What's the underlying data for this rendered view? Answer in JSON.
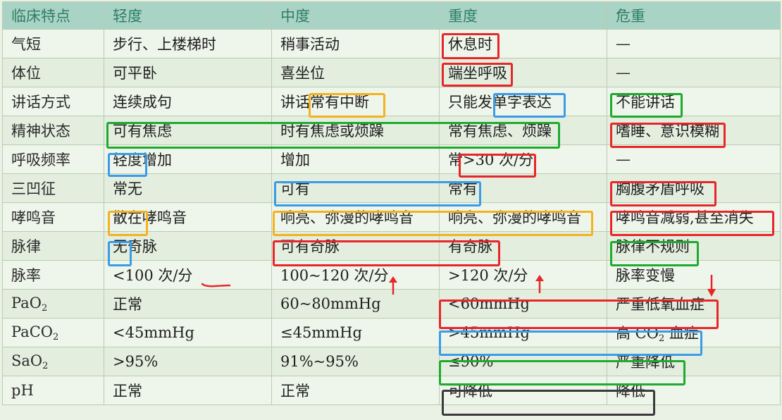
{
  "headers": [
    "临床特点",
    "轻度",
    "中度",
    "重度",
    "危重"
  ],
  "rows": [
    {
      "feature": "气短",
      "mild": "步行、上楼梯时",
      "moderate": "稍事活动",
      "severe": "休息时",
      "critical": "—"
    },
    {
      "feature": "体位",
      "mild": "可平卧",
      "moderate": "喜坐位",
      "severe": "端坐呼吸",
      "critical": "—"
    },
    {
      "feature": "讲话方式",
      "mild": "连续成句",
      "moderate": "讲话常有中断",
      "severe": "只能发单字表达",
      "critical": "不能讲话"
    },
    {
      "feature": "精神状态",
      "mild": "可有焦虑",
      "moderate": "时有焦虑或烦躁",
      "severe": "常有焦虑、烦躁",
      "critical": "嗜睡、意识模糊"
    },
    {
      "feature": "呼吸频率",
      "mild": "轻度增加",
      "moderate": "增加",
      "severe": "常>30 次/分",
      "critical": "—"
    },
    {
      "feature": "三凹征",
      "mild": "常无",
      "moderate": "可有",
      "severe": "常有",
      "critical": "胸腹矛盾呼吸"
    },
    {
      "feature": "哮鸣音",
      "mild": "散在哮鸣音",
      "moderate": "响亮、弥漫的哮鸣音",
      "severe": "响亮、弥漫的哮鸣音",
      "critical": "哮鸣音减弱,甚至消失"
    },
    {
      "feature": "脉律",
      "mild": "无奇脉",
      "moderate": "可有奇脉",
      "severe": "有奇脉",
      "critical": "脉律不规则"
    },
    {
      "feature": "脉率",
      "mild": "<100 次/分",
      "moderate": "100~120 次/分",
      "severe": ">120 次/分",
      "critical": "脉率变慢"
    },
    {
      "feature_main": "PaO",
      "feature_sub": "2",
      "mild": "正常",
      "moderate": "60~80mmHg",
      "severe": "<60mmHg",
      "critical": "严重低氧血症"
    },
    {
      "feature_main": "PaCO",
      "feature_sub": "2",
      "mild": "<45mmHg",
      "moderate": "≤45mmHg",
      "severe": ">45mmHg",
      "critical_pre": "高 CO",
      "critical_sub": "2",
      "critical_post": " 血症"
    },
    {
      "feature_main": "SaO",
      "feature_sub": "2",
      "mild": ">95%",
      "moderate": "91%~95%",
      "severe": "≤90%",
      "critical": "严重降低"
    },
    {
      "feature": "pH",
      "mild": "正常",
      "moderate": "正常",
      "severe": "可降低",
      "critical": "降低"
    }
  ],
  "colors": {
    "header_bg": "#a9d3c4",
    "header_text": "#2f7d69",
    "annotation_red": "#e8262a",
    "annotation_orange": "#f3b21f",
    "annotation_blue": "#3a9be8",
    "annotation_green": "#1daa2f",
    "annotation_black": "#3a3a3a"
  }
}
